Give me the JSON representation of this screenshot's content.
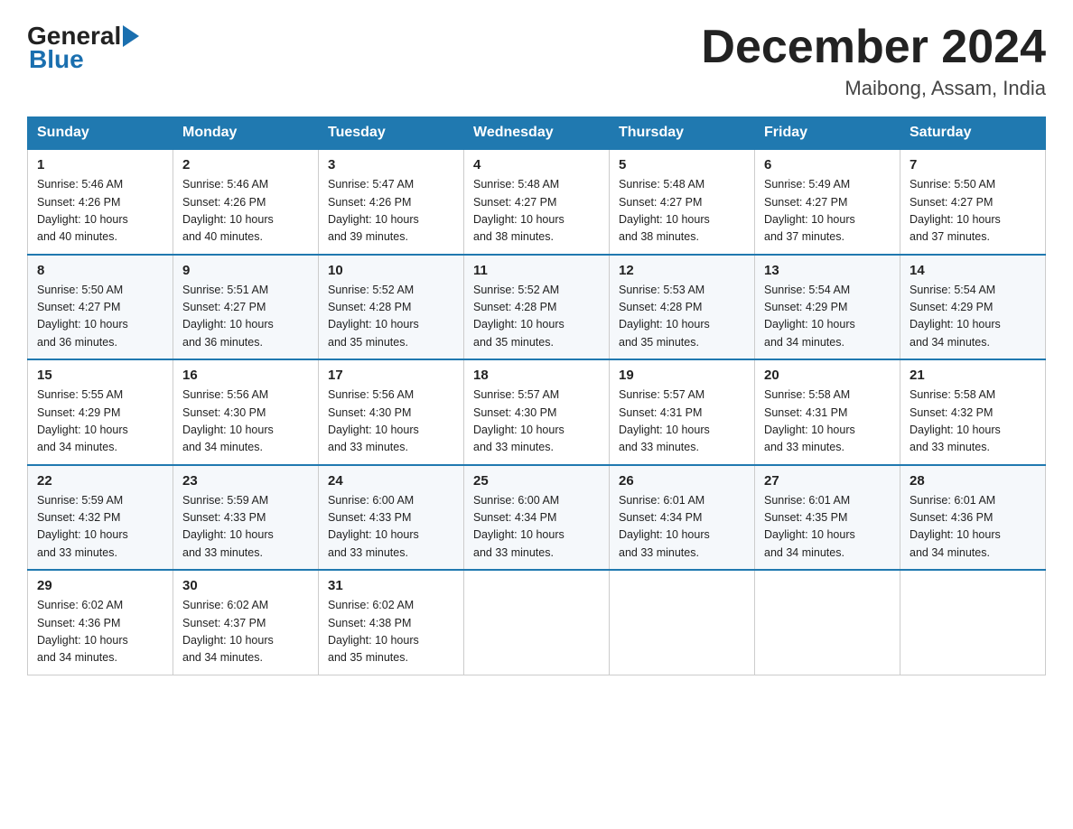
{
  "logo": {
    "text_general": "General",
    "text_blue": "Blue"
  },
  "title": {
    "month_year": "December 2024",
    "location": "Maibong, Assam, India"
  },
  "days_of_week": [
    "Sunday",
    "Monday",
    "Tuesday",
    "Wednesday",
    "Thursday",
    "Friday",
    "Saturday"
  ],
  "weeks": [
    [
      {
        "day": "1",
        "sunrise": "5:46 AM",
        "sunset": "4:26 PM",
        "daylight": "10 hours and 40 minutes."
      },
      {
        "day": "2",
        "sunrise": "5:46 AM",
        "sunset": "4:26 PM",
        "daylight": "10 hours and 40 minutes."
      },
      {
        "day": "3",
        "sunrise": "5:47 AM",
        "sunset": "4:26 PM",
        "daylight": "10 hours and 39 minutes."
      },
      {
        "day": "4",
        "sunrise": "5:48 AM",
        "sunset": "4:27 PM",
        "daylight": "10 hours and 38 minutes."
      },
      {
        "day": "5",
        "sunrise": "5:48 AM",
        "sunset": "4:27 PM",
        "daylight": "10 hours and 38 minutes."
      },
      {
        "day": "6",
        "sunrise": "5:49 AM",
        "sunset": "4:27 PM",
        "daylight": "10 hours and 37 minutes."
      },
      {
        "day": "7",
        "sunrise": "5:50 AM",
        "sunset": "4:27 PM",
        "daylight": "10 hours and 37 minutes."
      }
    ],
    [
      {
        "day": "8",
        "sunrise": "5:50 AM",
        "sunset": "4:27 PM",
        "daylight": "10 hours and 36 minutes."
      },
      {
        "day": "9",
        "sunrise": "5:51 AM",
        "sunset": "4:27 PM",
        "daylight": "10 hours and 36 minutes."
      },
      {
        "day": "10",
        "sunrise": "5:52 AM",
        "sunset": "4:28 PM",
        "daylight": "10 hours and 35 minutes."
      },
      {
        "day": "11",
        "sunrise": "5:52 AM",
        "sunset": "4:28 PM",
        "daylight": "10 hours and 35 minutes."
      },
      {
        "day": "12",
        "sunrise": "5:53 AM",
        "sunset": "4:28 PM",
        "daylight": "10 hours and 35 minutes."
      },
      {
        "day": "13",
        "sunrise": "5:54 AM",
        "sunset": "4:29 PM",
        "daylight": "10 hours and 34 minutes."
      },
      {
        "day": "14",
        "sunrise": "5:54 AM",
        "sunset": "4:29 PM",
        "daylight": "10 hours and 34 minutes."
      }
    ],
    [
      {
        "day": "15",
        "sunrise": "5:55 AM",
        "sunset": "4:29 PM",
        "daylight": "10 hours and 34 minutes."
      },
      {
        "day": "16",
        "sunrise": "5:56 AM",
        "sunset": "4:30 PM",
        "daylight": "10 hours and 34 minutes."
      },
      {
        "day": "17",
        "sunrise": "5:56 AM",
        "sunset": "4:30 PM",
        "daylight": "10 hours and 33 minutes."
      },
      {
        "day": "18",
        "sunrise": "5:57 AM",
        "sunset": "4:30 PM",
        "daylight": "10 hours and 33 minutes."
      },
      {
        "day": "19",
        "sunrise": "5:57 AM",
        "sunset": "4:31 PM",
        "daylight": "10 hours and 33 minutes."
      },
      {
        "day": "20",
        "sunrise": "5:58 AM",
        "sunset": "4:31 PM",
        "daylight": "10 hours and 33 minutes."
      },
      {
        "day": "21",
        "sunrise": "5:58 AM",
        "sunset": "4:32 PM",
        "daylight": "10 hours and 33 minutes."
      }
    ],
    [
      {
        "day": "22",
        "sunrise": "5:59 AM",
        "sunset": "4:32 PM",
        "daylight": "10 hours and 33 minutes."
      },
      {
        "day": "23",
        "sunrise": "5:59 AM",
        "sunset": "4:33 PM",
        "daylight": "10 hours and 33 minutes."
      },
      {
        "day": "24",
        "sunrise": "6:00 AM",
        "sunset": "4:33 PM",
        "daylight": "10 hours and 33 minutes."
      },
      {
        "day": "25",
        "sunrise": "6:00 AM",
        "sunset": "4:34 PM",
        "daylight": "10 hours and 33 minutes."
      },
      {
        "day": "26",
        "sunrise": "6:01 AM",
        "sunset": "4:34 PM",
        "daylight": "10 hours and 33 minutes."
      },
      {
        "day": "27",
        "sunrise": "6:01 AM",
        "sunset": "4:35 PM",
        "daylight": "10 hours and 34 minutes."
      },
      {
        "day": "28",
        "sunrise": "6:01 AM",
        "sunset": "4:36 PM",
        "daylight": "10 hours and 34 minutes."
      }
    ],
    [
      {
        "day": "29",
        "sunrise": "6:02 AM",
        "sunset": "4:36 PM",
        "daylight": "10 hours and 34 minutes."
      },
      {
        "day": "30",
        "sunrise": "6:02 AM",
        "sunset": "4:37 PM",
        "daylight": "10 hours and 34 minutes."
      },
      {
        "day": "31",
        "sunrise": "6:02 AM",
        "sunset": "4:38 PM",
        "daylight": "10 hours and 35 minutes."
      },
      null,
      null,
      null,
      null
    ]
  ],
  "labels": {
    "sunrise": "Sunrise:",
    "sunset": "Sunset:",
    "daylight": "Daylight:"
  }
}
